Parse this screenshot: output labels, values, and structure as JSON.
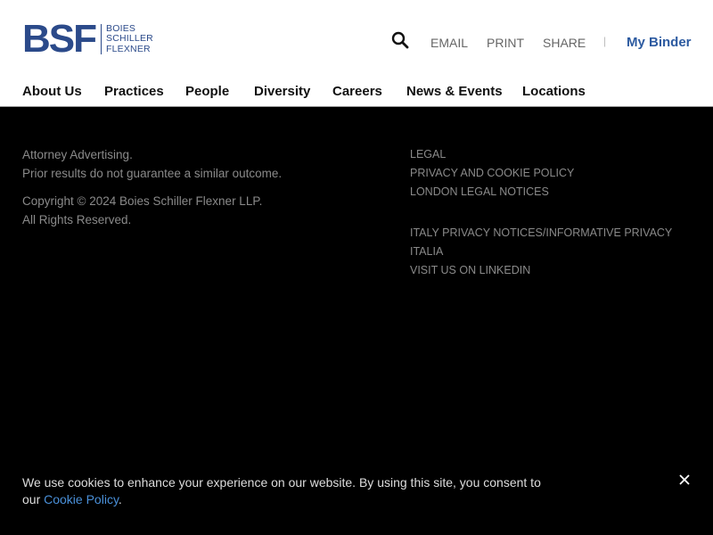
{
  "header": {
    "logo": {
      "mark": "BSF",
      "words": [
        "BOIES",
        "SCHILLER",
        "FLEXNER"
      ],
      "color": "#2b4a8a"
    },
    "utility": {
      "search_icon": "search-icon",
      "email": "EMAIL",
      "print": "PRINT",
      "share": "SHARE",
      "separator": "|",
      "binder": "My Binder"
    },
    "nav": [
      "About Us",
      "Practices",
      "People",
      "Diversity",
      "Careers",
      "News & Events",
      "Locations"
    ]
  },
  "footer": {
    "left": {
      "line1": "Attorney Advertising.",
      "line2": "Prior results do not guarantee a similar outcome.",
      "line3": "Copyright © 2024 Boies Schiller Flexner LLP.",
      "line4": "All Rights Reserved."
    },
    "links": {
      "legal": "LEGAL",
      "privacy": "PRIVACY AND COOKIE POLICY",
      "london": "LONDON LEGAL NOTICES",
      "italy": "ITALY PRIVACY NOTICES/INFORMATIVE PRIVACY",
      "italia": "ITALIA",
      "linkedin": "VISIT US ON LINKEDIN"
    }
  },
  "cookie_banner": {
    "text": "We use cookies to enhance your experience on our website. By using this site, you consent to our ",
    "link": "Cookie Policy",
    "end": ".",
    "close_icon": "close-icon"
  },
  "colors": {
    "brand": "#2b4a8a",
    "binder": "#2c5aa0",
    "link": "#4a90d9",
    "background": "#000000"
  }
}
